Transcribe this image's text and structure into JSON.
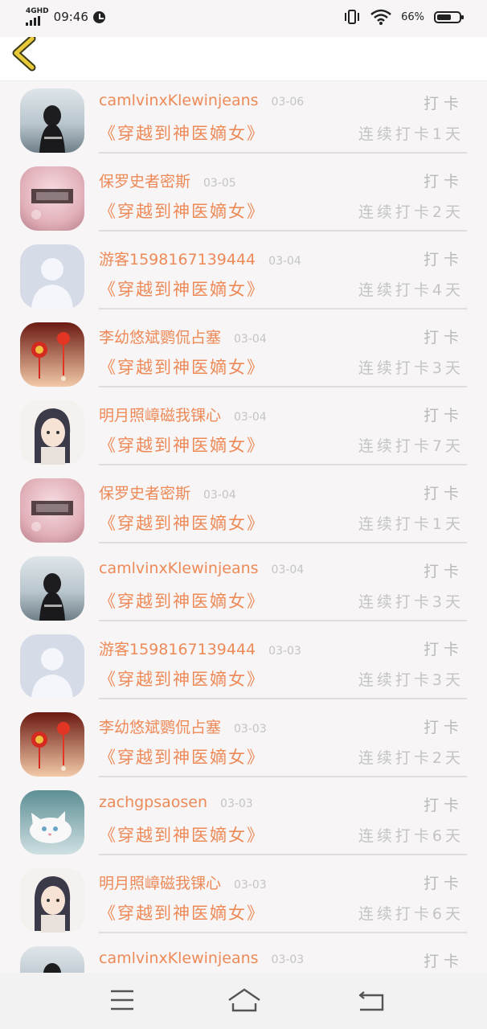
{
  "status_bar": {
    "network": "4GHD",
    "time": "09:46",
    "battery_percent": "66%",
    "battery_level": 0.66,
    "icons": [
      "signal-icon",
      "alarm-clock-icon",
      "vibrate-icon",
      "wifi-icon",
      "battery-icon"
    ]
  },
  "nav": {
    "back_icon": "chevron-left-icon"
  },
  "checkins": [
    {
      "name": "camlvinxKlewinjeans",
      "date": "03-06",
      "action": "打卡",
      "book": "《穿越到神医嫡女》",
      "streak": "连续打卡1天",
      "avatar": "girl-sea"
    },
    {
      "name": "保罗史者密斯",
      "date": "03-05",
      "action": "打卡",
      "book": "《穿越到神医嫡女》",
      "streak": "连续打卡2天",
      "avatar": "pink-text"
    },
    {
      "name": "游客1598167139444",
      "date": "03-04",
      "action": "打卡",
      "book": "《穿越到神医嫡女》",
      "streak": "连续打卡4天",
      "avatar": "default"
    },
    {
      "name": "李幼悠斌鹦侃占塞",
      "date": "03-04",
      "action": "打卡",
      "book": "《穿越到神医嫡女》",
      "streak": "连续打卡3天",
      "avatar": "lantern"
    },
    {
      "name": "明月照嶂磁我锞心",
      "date": "03-04",
      "action": "打卡",
      "book": "《穿越到神医嫡女》",
      "streak": "连续打卡7天",
      "avatar": "anime"
    },
    {
      "name": "保罗史者密斯",
      "date": "03-04",
      "action": "打卡",
      "book": "《穿越到神医嫡女》",
      "streak": "连续打卡1天",
      "avatar": "pink-text"
    },
    {
      "name": "camlvinxKlewinjeans",
      "date": "03-04",
      "action": "打卡",
      "book": "《穿越到神医嫡女》",
      "streak": "连续打卡3天",
      "avatar": "girl-sea"
    },
    {
      "name": "游客1598167139444",
      "date": "03-03",
      "action": "打卡",
      "book": "《穿越到神医嫡女》",
      "streak": "连续打卡3天",
      "avatar": "default"
    },
    {
      "name": "李幼悠斌鹦侃占塞",
      "date": "03-03",
      "action": "打卡",
      "book": "《穿越到神医嫡女》",
      "streak": "连续打卡2天",
      "avatar": "lantern"
    },
    {
      "name": "zachgpsaosen",
      "date": "03-03",
      "action": "打卡",
      "book": "《穿越到神医嫡女》",
      "streak": "连续打卡6天",
      "avatar": "cat"
    },
    {
      "name": "明月照嶂磁我锞心",
      "date": "03-03",
      "action": "打卡",
      "book": "《穿越到神医嫡女》",
      "streak": "连续打卡6天",
      "avatar": "anime"
    },
    {
      "name": "camlvinxKlewinjeans",
      "date": "03-03",
      "action": "打卡",
      "book": "",
      "streak": "",
      "avatar": "girl-sea"
    }
  ],
  "system_nav": {
    "icons": [
      "menu-icon",
      "home-icon",
      "return-icon"
    ]
  },
  "colors": {
    "accent": "#ee8a58",
    "muted": "#c4c4c4",
    "back_chevron": "#e7c93a",
    "divider": "#dedede"
  }
}
